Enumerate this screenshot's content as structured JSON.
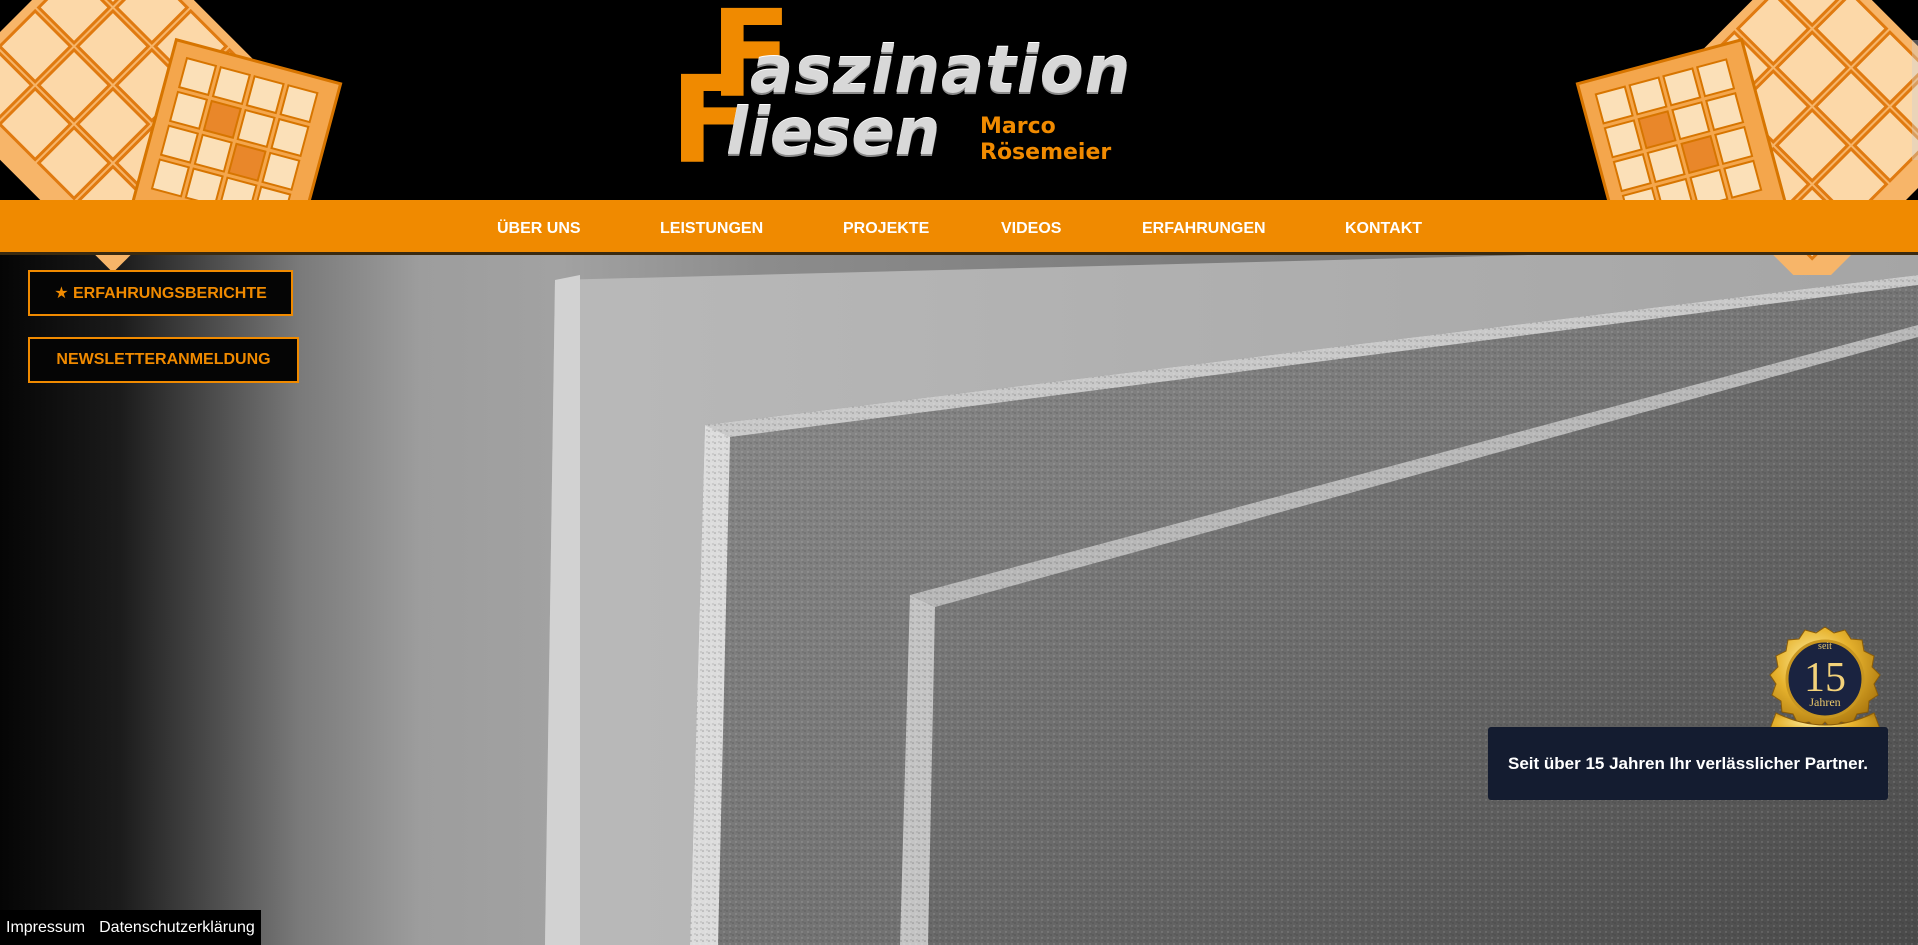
{
  "brand": {
    "logo_line1": "aszination",
    "logo_line2": "liesen",
    "logo_initial1": "F",
    "logo_initial2": "F",
    "owner_first": "Marco",
    "owner_last": "Rösemeier",
    "accent_color": "#f08a00"
  },
  "nav": {
    "items": [
      {
        "label": "Über uns"
      },
      {
        "label": "Leistungen"
      },
      {
        "label": "Projekte"
      },
      {
        "label": "Videos"
      },
      {
        "label": "Erfahrungen"
      },
      {
        "label": "Kontakt"
      }
    ]
  },
  "side_buttons": {
    "reviews": "★ ERFAHRUNGSBERICHTE",
    "newsletter": "NEWSLETTERANMELDUNG"
  },
  "badge": {
    "top_text": "seit",
    "number": "15",
    "bottom_text": "Jahren",
    "caption": "Seit über 15 Jahren Ihr verlässlicher Partner."
  },
  "footer": {
    "imprint": "Impressum",
    "privacy": "Datenschutzerklärung"
  }
}
